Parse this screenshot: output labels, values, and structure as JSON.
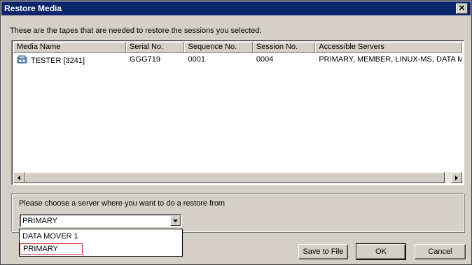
{
  "window": {
    "title": "Restore Media",
    "close_glyph": "✕"
  },
  "instruction": "These are the tapes that are needed to restore the sessions you selected:",
  "table": {
    "columns": [
      "Media Name",
      "Serial No.",
      "Sequence No.",
      "Session No.",
      "Accessible Servers"
    ],
    "rows": [
      {
        "icon": "tape-media-icon",
        "media_name": "TESTER [3241]",
        "serial": "GGG719",
        "sequence": "0001",
        "session": "0004",
        "servers": "PRIMARY, MEMBER, LINUX-MS, DATA M"
      }
    ]
  },
  "server_choice": {
    "label": "Please choose a server where you want to do a restore from",
    "selected": "PRIMARY",
    "options": [
      "DATA MOVER 1",
      "PRIMARY"
    ],
    "highlight_color": "#d42a2a"
  },
  "buttons": {
    "save_to_file": "Save to File",
    "ok": "OK",
    "cancel": "Cancel"
  },
  "colors": {
    "titlebar": "#0a246a",
    "dialog": "#d4d0c8"
  }
}
